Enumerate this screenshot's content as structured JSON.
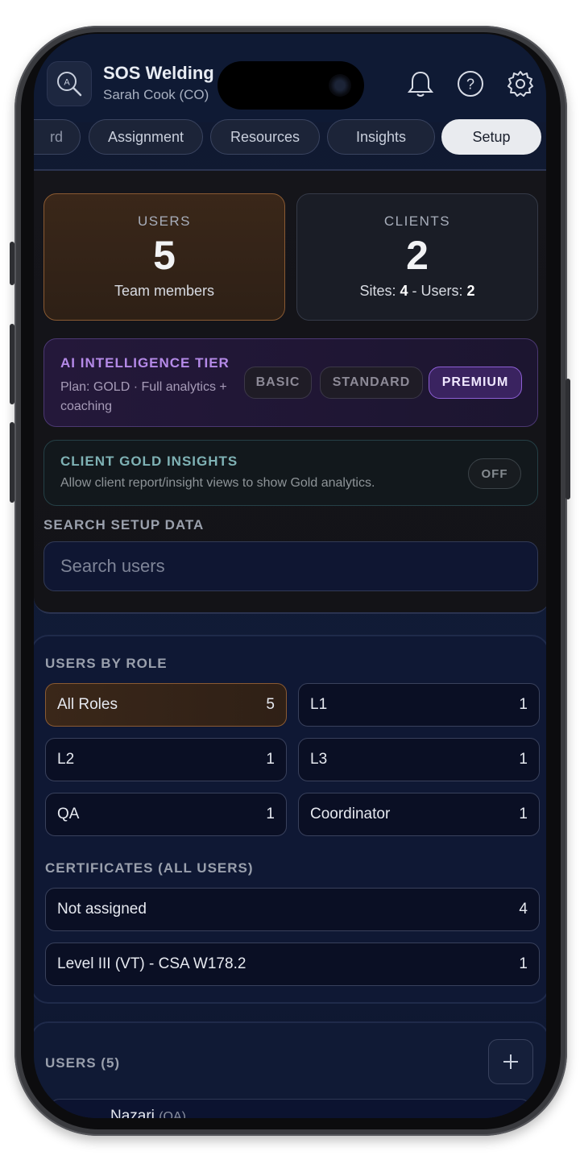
{
  "header": {
    "app_name": "SOS Welding",
    "user": "Sarah Cook (CO)"
  },
  "tabs": [
    {
      "label": "rd"
    },
    {
      "label": "Assignment"
    },
    {
      "label": "Resources"
    },
    {
      "label": "Insights"
    },
    {
      "label": "Setup",
      "active": true
    }
  ],
  "stats": {
    "users": {
      "label": "USERS",
      "value": "5",
      "sub": "Team members"
    },
    "clients": {
      "label": "CLIENTS",
      "value": "2",
      "sites_label": "Sites:",
      "sites": "4",
      "sep": " - ",
      "users_label": "Users:",
      "users": "2"
    }
  },
  "ai_tier": {
    "title": "AI INTELLIGENCE TIER",
    "plan": "Plan: GOLD · Full analytics + coaching",
    "options": [
      "BASIC",
      "STANDARD",
      "PREMIUM"
    ],
    "selected": "PREMIUM"
  },
  "gold_insights": {
    "title": "CLIENT GOLD INSIGHTS",
    "description": "Allow client report/insight views to show Gold analytics.",
    "toggle": "OFF"
  },
  "search": {
    "label": "SEARCH SETUP DATA",
    "placeholder": "Search users"
  },
  "roles": {
    "label": "USERS BY ROLE",
    "items": [
      {
        "name": "All Roles",
        "count": "5",
        "active": true
      },
      {
        "name": "L1",
        "count": "1"
      },
      {
        "name": "L2",
        "count": "1"
      },
      {
        "name": "L3",
        "count": "1"
      },
      {
        "name": "QA",
        "count": "1"
      },
      {
        "name": "Coordinator",
        "count": "1"
      }
    ]
  },
  "certificates": {
    "label": "CERTIFICATES (ALL USERS)",
    "items": [
      {
        "name": "Not assigned",
        "count": "4"
      },
      {
        "name": "Level III (VT) - CSA W178.2",
        "count": "1"
      }
    ]
  },
  "users_list": {
    "label": "USERS (5)",
    "first_name": "Nazari",
    "first_role": "(QA)"
  },
  "colors": {
    "accent_orange": "#8a5a32",
    "accent_purple": "#8d5fd4",
    "teal": "#7fb2b5"
  }
}
